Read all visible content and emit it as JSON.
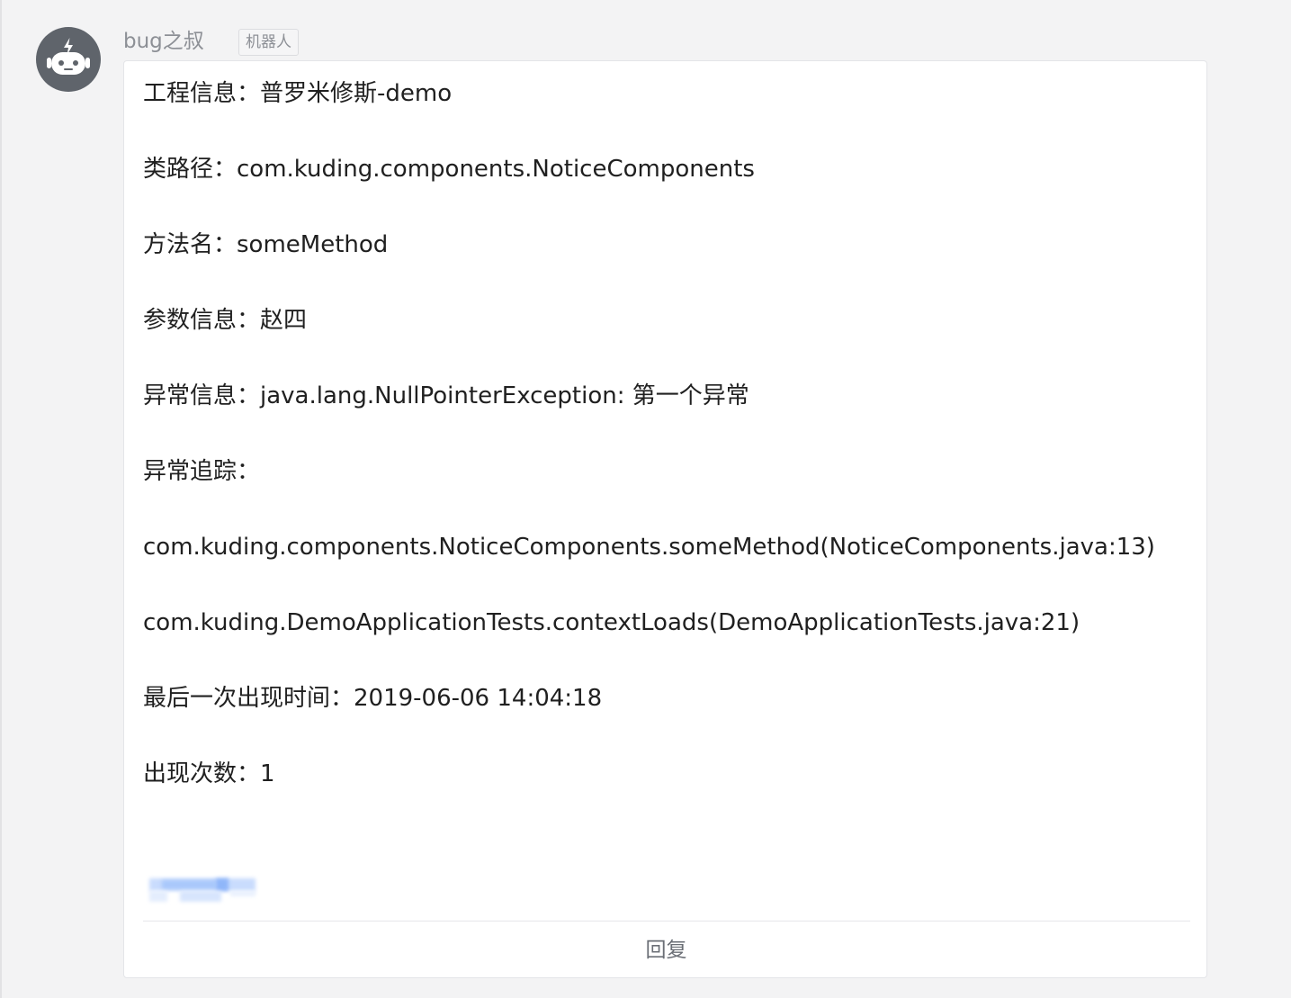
{
  "sender": {
    "name": "bug之叔",
    "tag": "机器人",
    "avatar_icon": "robot-icon"
  },
  "message": {
    "lines": [
      "工程信息：普罗米修斯-demo",
      "类路径：com.kuding.components.NoticeComponents",
      "方法名：someMethod",
      "参数信息：赵四",
      "异常信息：java.lang.NullPointerException: 第一个异常",
      "异常追踪：",
      "com.kuding.components.NoticeComponents.someMethod(NoticeComponents.java:13)",
      "com.kuding.DemoApplicationTests.contextLoads(DemoApplicationTests.java:21)",
      "最后一次出现时间：2019-06-06 14:04:18",
      "出现次数：1"
    ]
  },
  "actions": {
    "reply_label": "回复"
  },
  "colors": {
    "background": "#f3f3f4",
    "card": "#ffffff",
    "avatar": "#5f646b",
    "blur_blue": "#9fc4fb"
  }
}
